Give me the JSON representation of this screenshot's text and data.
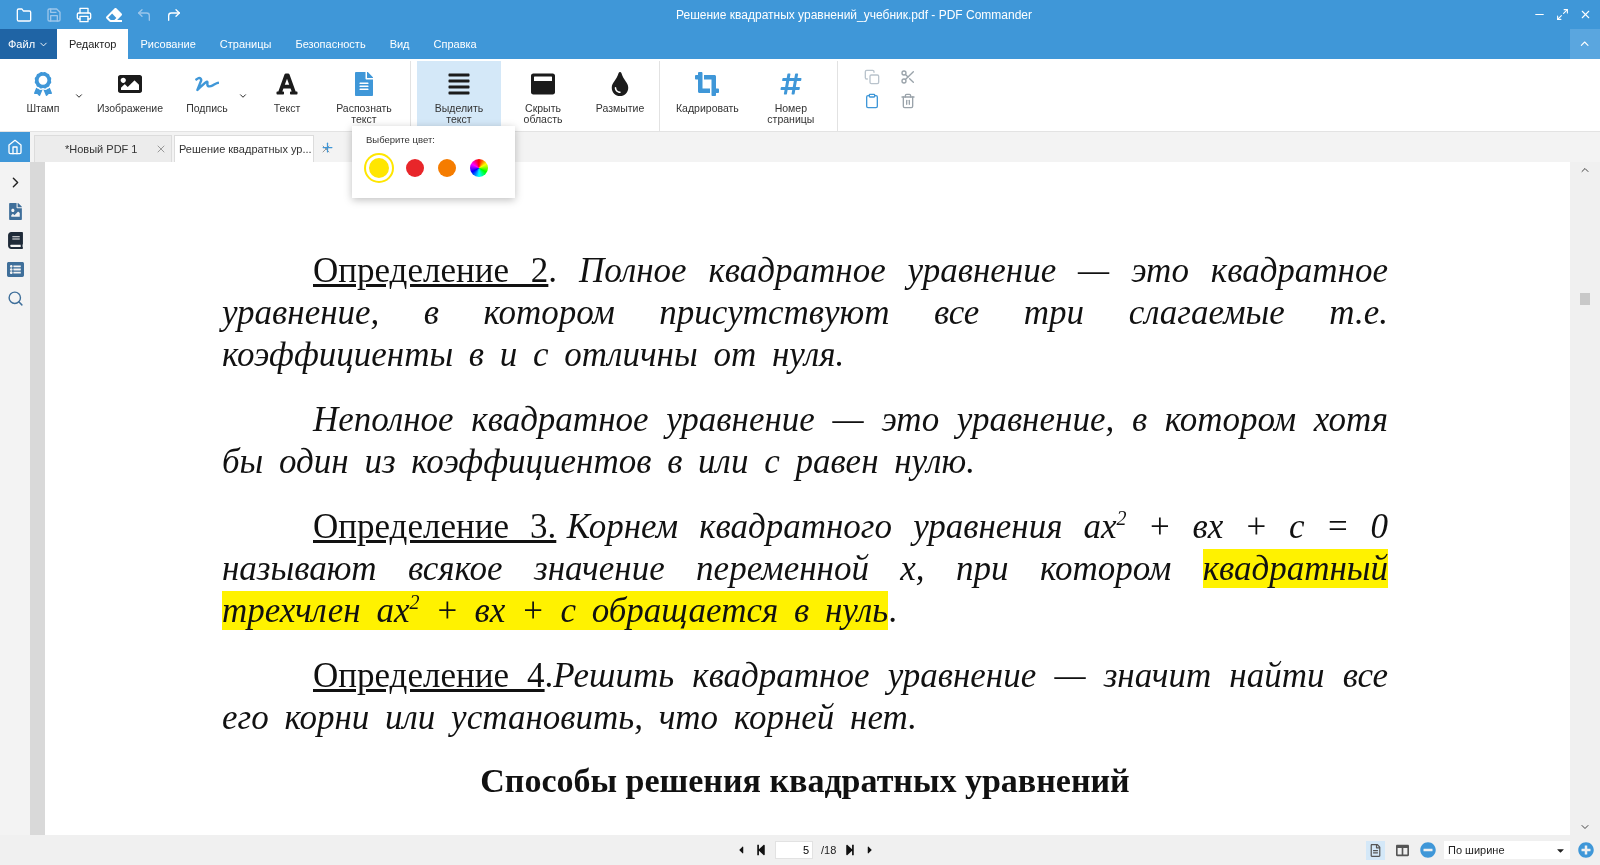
{
  "window": {
    "title": "Решение квадратных уравнений_учебник.pdf - PDF Commander"
  },
  "menu": {
    "file": "Файл",
    "tabs": [
      {
        "label": "Редактор",
        "selected": true
      },
      {
        "label": "Рисование",
        "selected": false
      },
      {
        "label": "Страницы",
        "selected": false
      },
      {
        "label": "Безопасность",
        "selected": false
      },
      {
        "label": "Вид",
        "selected": false
      },
      {
        "label": "Справка",
        "selected": false
      }
    ]
  },
  "ribbon": {
    "groups": [
      [
        {
          "label": "Штамп",
          "selected": false,
          "dropdown": true
        },
        {
          "label": "Изображение",
          "selected": false,
          "dropdown": false
        },
        {
          "label": "Подпись",
          "selected": false,
          "dropdown": true
        },
        {
          "label": "Текст",
          "selected": false,
          "dropdown": false
        },
        {
          "label": "Распознать текст",
          "selected": false,
          "dropdown": false
        }
      ],
      [
        {
          "label": "Выделить текст",
          "selected": true,
          "dropdown": false
        },
        {
          "label": "Скрыть область",
          "selected": false,
          "dropdown": false
        },
        {
          "label": "Размытие",
          "selected": false,
          "dropdown": false
        }
      ],
      [
        {
          "label": "Кадрировать",
          "selected": false,
          "dropdown": false
        },
        {
          "label": "Номер страницы",
          "selected": false,
          "dropdown": false
        }
      ]
    ]
  },
  "color_popup": {
    "title": "Выберите цвет:",
    "swatches": [
      {
        "kind": "solid",
        "color": "#ffe600",
        "selected": true
      },
      {
        "kind": "solid",
        "color": "#e8262a",
        "selected": false
      },
      {
        "kind": "solid",
        "color": "#f57c00",
        "selected": false
      },
      {
        "kind": "palette",
        "selected": false
      }
    ]
  },
  "doc_tabs": [
    {
      "label": "*Новый PDF 1",
      "selected": false
    },
    {
      "label": "Решение квадратных ур...",
      "selected": true
    }
  ],
  "document": {
    "paragraphs": [
      [
        {
          "kind": "label",
          "text": "Определение 2"
        },
        {
          "kind": "plain",
          "text": ". "
        },
        {
          "kind": "italic",
          "text": "Полное квадратное уравнение — это квадратное уравнение, в котором присутствуют все три слагаемые т.е. коэффициенты в и с отличны от нуля."
        }
      ],
      [
        {
          "kind": "italic",
          "text": "Неполное квадратное уравнение — это уравнение, в котором хотя бы один из коэффициентов в или с равен нулю."
        }
      ],
      [
        {
          "kind": "label",
          "text": "Определение 3."
        },
        {
          "kind": "italic",
          "text": "Корнем квадратного уравнения ах$^{2}$ + вх + с = 0 называют всякое значение переменной х, при котором "
        },
        {
          "kind": "highlight",
          "text": "квадратный трехчлен ах$^{2}$ + вх + с обращается в нуль"
        },
        {
          "kind": "plain",
          "text": "."
        }
      ],
      [
        {
          "kind": "label",
          "text": "Определение 4"
        },
        {
          "kind": "plain",
          "text": "."
        },
        {
          "kind": "italic",
          "text": "Решить квадратное уравнение — значит найти все его корни или установить, что корней нет."
        }
      ]
    ],
    "heading": "Способы решения квадратных уравнений"
  },
  "status_bar": {
    "page": "5",
    "total": "/18",
    "zoom": "По ширине"
  }
}
